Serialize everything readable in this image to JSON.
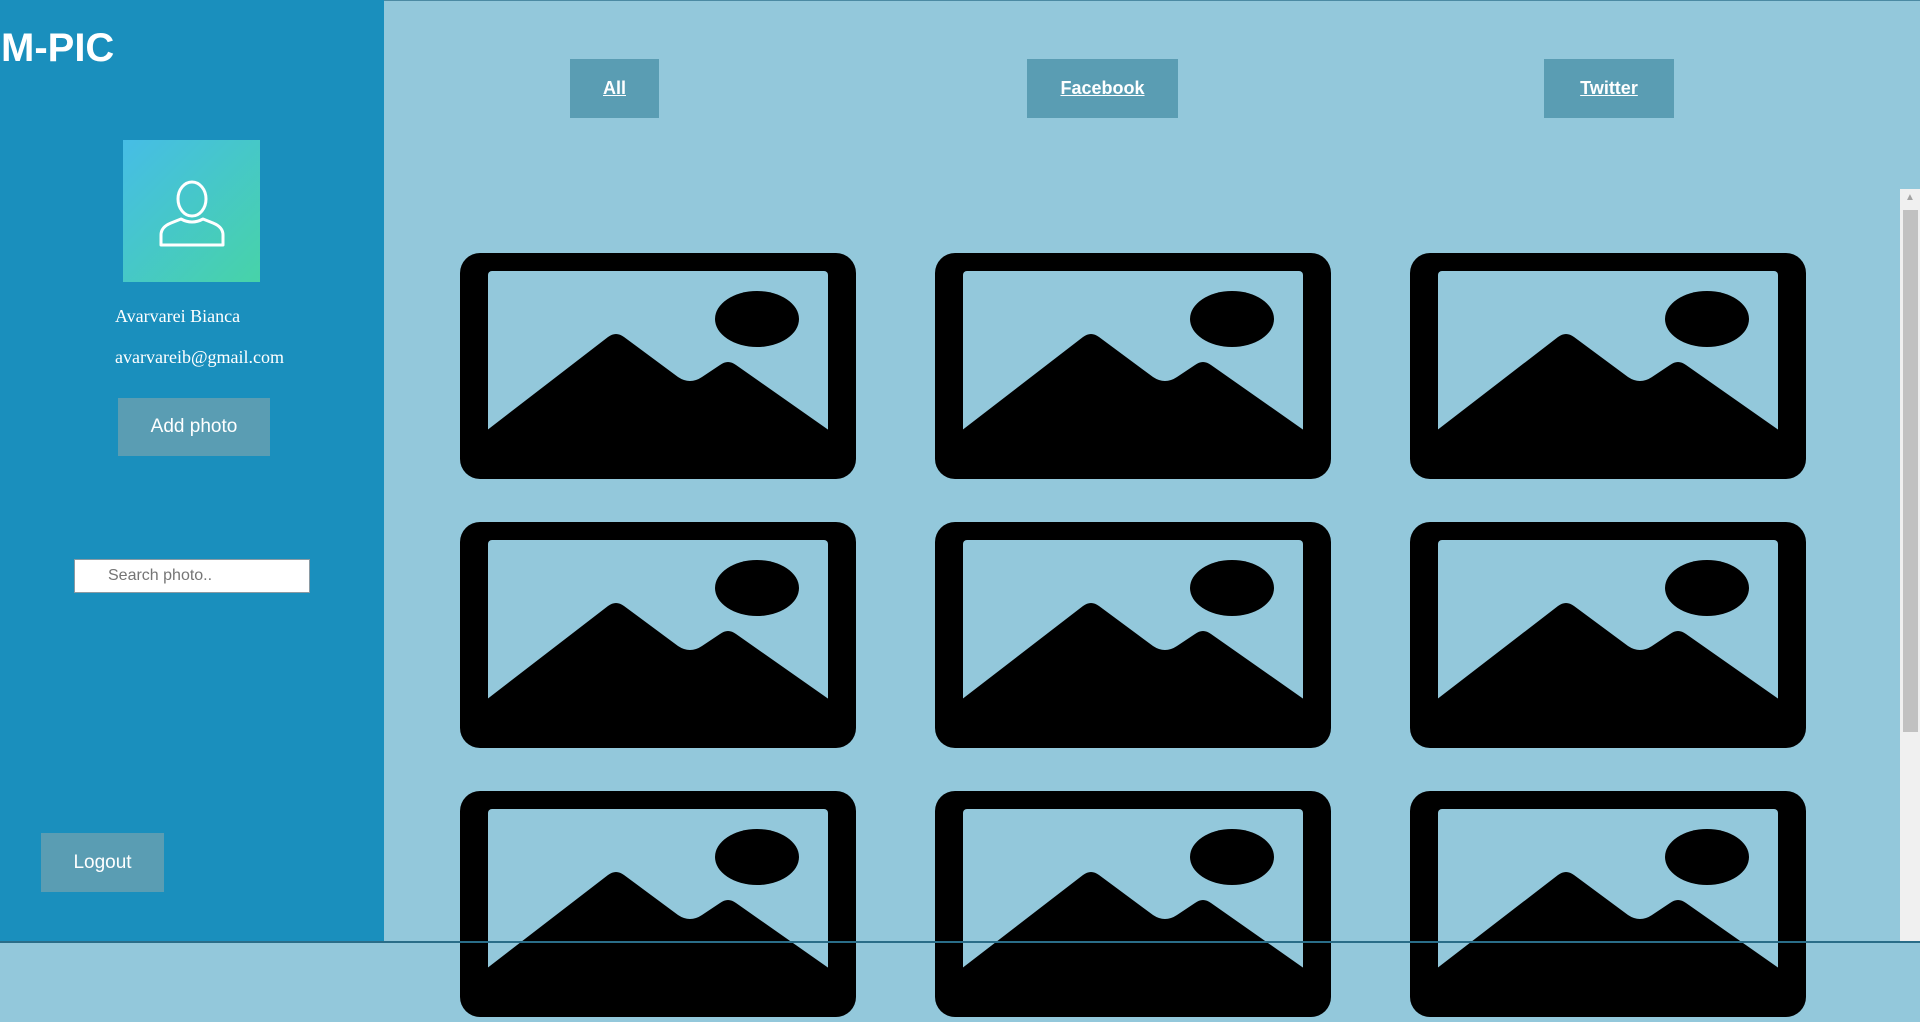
{
  "app": {
    "title": "M-PIC"
  },
  "profile": {
    "avatar_icon": "user-icon",
    "name": "Avarvarei Bianca",
    "email": "avarvareib@gmail.com"
  },
  "sidebar": {
    "add_photo_label": "Add photo",
    "search_placeholder": "Search photo..",
    "search_value": "",
    "logout_label": "Logout"
  },
  "filters": {
    "all_label": "All",
    "facebook_label": "Facebook",
    "twitter_label": "Twitter"
  },
  "gallery": {
    "item_icon": "image-icon",
    "item_count": 9
  },
  "colors": {
    "sidebar": "#1a8fbd",
    "main_background": "#93c8db",
    "button": "#5a9db3",
    "avatar_gradient_start": "#46bde6",
    "avatar_gradient_end": "#47d3a8"
  }
}
